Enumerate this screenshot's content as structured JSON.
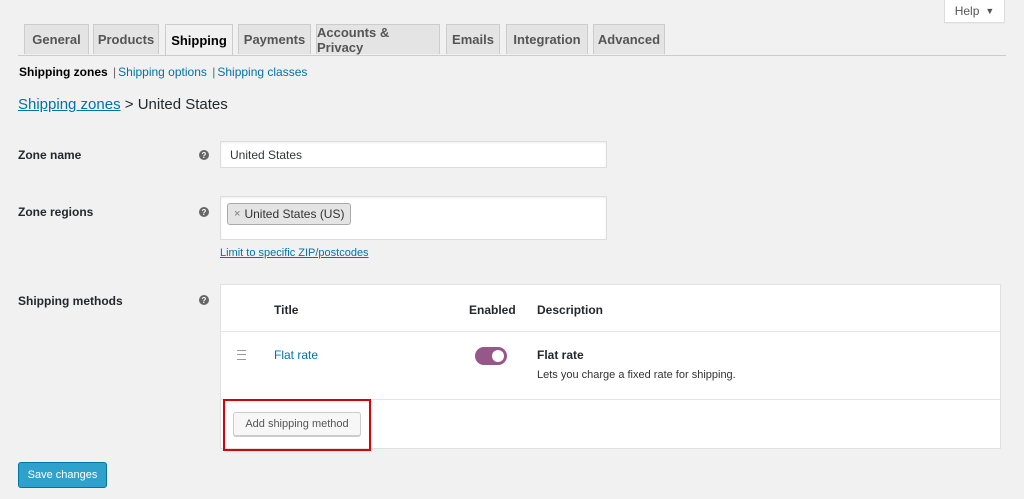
{
  "help": {
    "label": "Help",
    "caret": "▼"
  },
  "tabs": [
    {
      "label": "General"
    },
    {
      "label": "Products"
    },
    {
      "label": "Shipping",
      "active": true
    },
    {
      "label": "Payments"
    },
    {
      "label": "Accounts & Privacy"
    },
    {
      "label": "Emails"
    },
    {
      "label": "Integration"
    },
    {
      "label": "Advanced"
    }
  ],
  "subnav": {
    "current": "Shipping zones",
    "separator": "|",
    "links": [
      "Shipping options",
      "Shipping classes"
    ]
  },
  "breadcrumb": {
    "parent": "Shipping zones",
    "separator": ">",
    "current": "United States"
  },
  "form": {
    "zone_name": {
      "label": "Zone name",
      "value": "United States"
    },
    "zone_regions": {
      "label": "Zone regions",
      "chips": [
        {
          "remove": "×",
          "label": "United States (US)"
        }
      ],
      "limit_link": "Limit to specific ZIP/postcodes"
    },
    "shipping_methods": {
      "label": "Shipping methods",
      "columns": {
        "title": "Title",
        "enabled": "Enabled",
        "description": "Description"
      },
      "rows": [
        {
          "title": "Flat rate",
          "enabled": true,
          "desc_title": "Flat rate",
          "desc_text": "Lets you charge a fixed rate for shipping."
        }
      ],
      "add_button": "Add shipping method"
    },
    "help_icon": "?"
  },
  "save_button": "Save changes",
  "colors": {
    "link": "#0073aa",
    "toggle_on": "#96588a",
    "primary_button": "#2ea2cc",
    "highlight": "#dd0000"
  }
}
